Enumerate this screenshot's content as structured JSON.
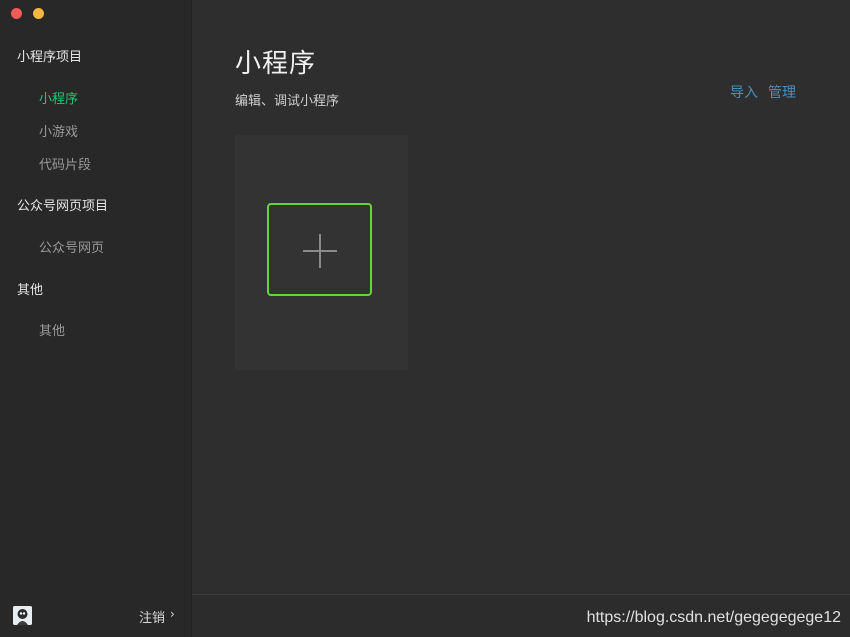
{
  "sidebar": {
    "sections": [
      {
        "title": "小程序项目",
        "items": [
          {
            "label": "小程序",
            "active": true
          },
          {
            "label": "小游戏",
            "active": false
          },
          {
            "label": "代码片段",
            "active": false
          }
        ]
      },
      {
        "title": "公众号网页项目",
        "items": [
          {
            "label": "公众号网页",
            "active": false
          }
        ]
      },
      {
        "title": "其他",
        "items": [
          {
            "label": "其他",
            "active": false
          }
        ]
      }
    ],
    "footer": {
      "logout_label": "注销",
      "chevron": "›",
      "avatar_icon": "avatar-icon"
    }
  },
  "main": {
    "title": "小程序",
    "subtitle": "编辑、调试小程序",
    "actions": {
      "import_label": "导入",
      "manage_label": "管理"
    },
    "add_card_icon": "plus-icon"
  },
  "watermark": "https://blog.csdn.net/gegegegege12",
  "colors": {
    "accent_active": "#1ecb6b",
    "link": "#4c8fb8",
    "highlight_border": "#66d43a",
    "close": "#f25b58",
    "minimize": "#f4b73f"
  }
}
